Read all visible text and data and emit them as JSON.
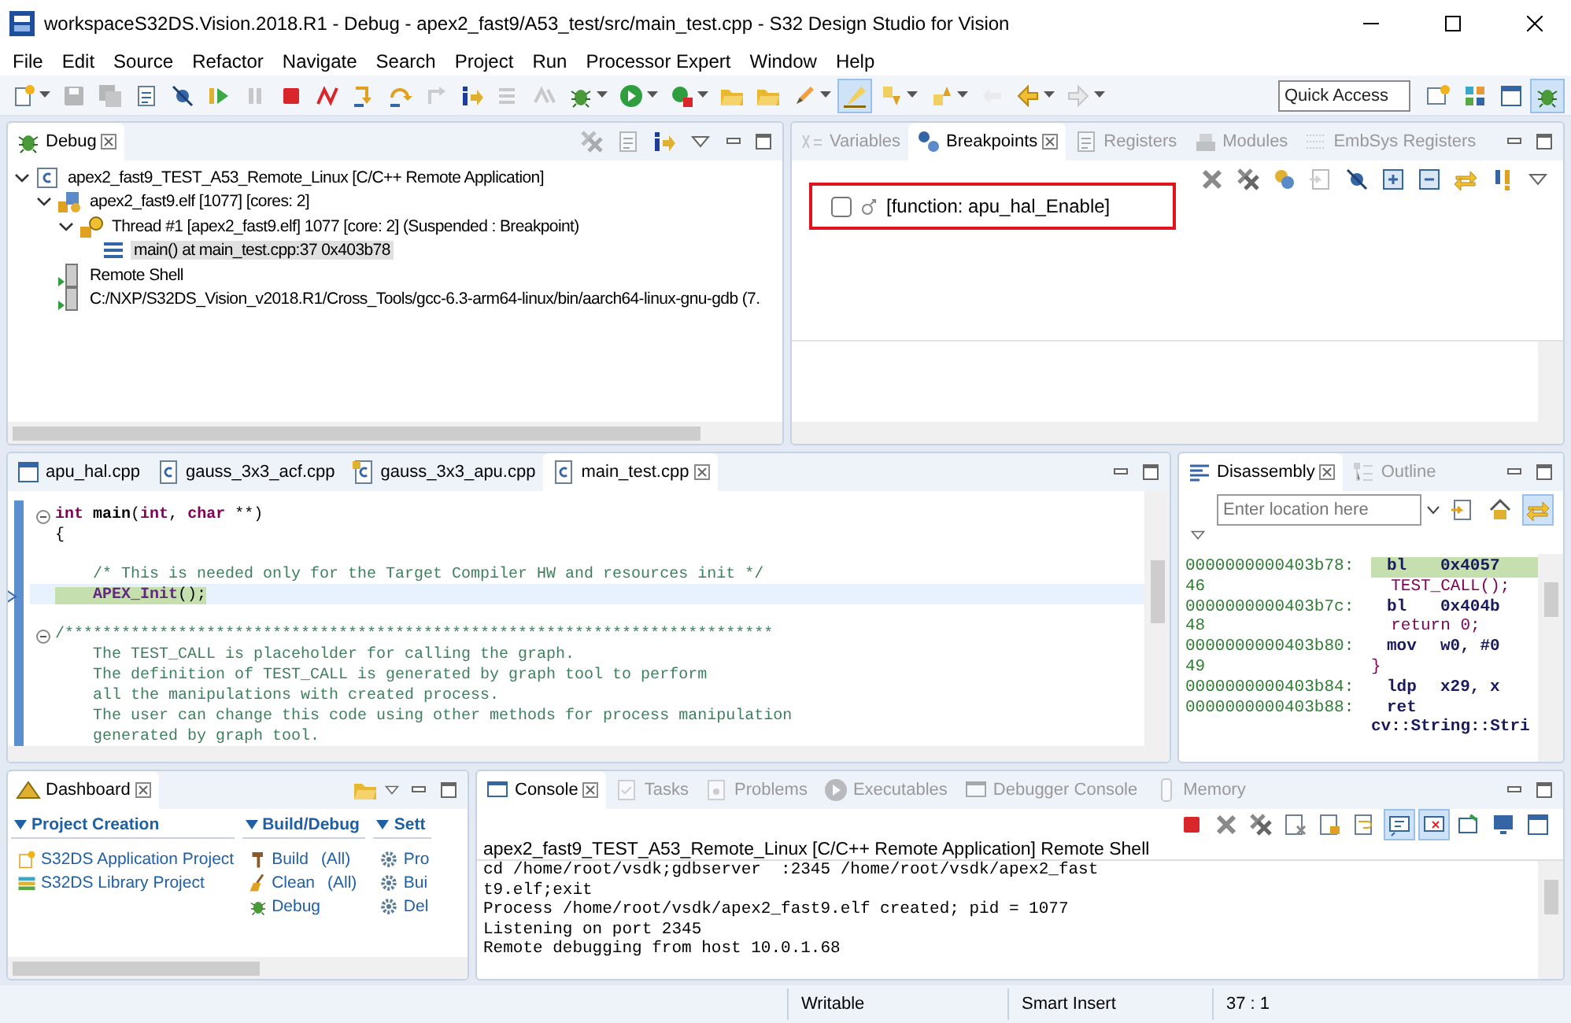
{
  "window": {
    "title": "workspaceS32DS.Vision.2018.R1 - Debug - apex2_fast9/A53_test/src/main_test.cpp - S32 Design Studio for Vision"
  },
  "menu": [
    "File",
    "Edit",
    "Source",
    "Refactor",
    "Navigate",
    "Search",
    "Project",
    "Run",
    "Processor Expert",
    "Window",
    "Help"
  ],
  "toolbar": [
    {
      "kind": "new",
      "disabled": false,
      "on": false,
      "dropdown": true
    },
    {
      "kind": "save",
      "disabled": true,
      "on": false,
      "dropdown": false
    },
    {
      "kind": "save-all",
      "disabled": true,
      "on": false,
      "dropdown": false
    },
    {
      "kind": "binary",
      "disabled": false,
      "on": false,
      "dropdown": false
    },
    {
      "kind": "skip",
      "disabled": false,
      "on": false,
      "dropdown": false
    },
    {
      "kind": "resume",
      "disabled": false,
      "on": false,
      "dropdown": false
    },
    {
      "kind": "suspend",
      "disabled": true,
      "on": false,
      "dropdown": false
    },
    {
      "kind": "terminate",
      "disabled": false,
      "on": false,
      "dropdown": false
    },
    {
      "kind": "disconnect",
      "disabled": false,
      "on": false,
      "dropdown": false
    },
    {
      "kind": "step-into",
      "disabled": false,
      "on": false,
      "dropdown": false
    },
    {
      "kind": "step-over",
      "disabled": false,
      "on": false,
      "dropdown": false
    },
    {
      "kind": "step-return",
      "disabled": true,
      "on": false,
      "dropdown": false
    },
    {
      "kind": "instr-step",
      "disabled": false,
      "on": false,
      "dropdown": false
    },
    {
      "kind": "drop-frame",
      "disabled": true,
      "on": false,
      "dropdown": false
    },
    {
      "kind": "reverse",
      "disabled": true,
      "on": false,
      "dropdown": false
    },
    {
      "kind": "bug",
      "disabled": false,
      "on": false,
      "dropdown": true
    },
    {
      "kind": "run",
      "disabled": false,
      "on": false,
      "dropdown": true
    },
    {
      "kind": "external",
      "disabled": false,
      "on": false,
      "dropdown": true
    },
    {
      "kind": "folder",
      "disabled": false,
      "on": false,
      "dropdown": false
    },
    {
      "kind": "folder",
      "disabled": false,
      "on": false,
      "dropdown": false
    },
    {
      "kind": "pen",
      "disabled": false,
      "on": false,
      "dropdown": true
    },
    {
      "kind": "highlight",
      "disabled": false,
      "on": true,
      "dropdown": false
    },
    {
      "kind": "next-ann",
      "disabled": false,
      "on": false,
      "dropdown": true
    },
    {
      "kind": "prev-ann",
      "disabled": false,
      "on": false,
      "dropdown": true
    },
    {
      "kind": "back-edit",
      "disabled": true,
      "on": false,
      "dropdown": false
    },
    {
      "kind": "back",
      "disabled": false,
      "on": false,
      "dropdown": true
    },
    {
      "kind": "forward",
      "disabled": true,
      "on": false,
      "dropdown": true
    }
  ],
  "quick_access": {
    "placeholder": "Quick Access"
  },
  "perspectives": [
    {
      "kind": "perspective",
      "selected": false
    },
    {
      "kind": "grid",
      "selected": false
    },
    {
      "kind": "window",
      "selected": false
    },
    {
      "kind": "bug",
      "selected": true
    }
  ],
  "debug_view": {
    "tabs": [
      {
        "label": "Debug",
        "kind": "bug",
        "selected": true
      }
    ],
    "toolbar": [
      {
        "kind": "remove-all",
        "disabled": true
      },
      {
        "kind": "binary",
        "disabled": true
      },
      {
        "kind": "instr-step",
        "disabled": false
      },
      {
        "kind": "menu",
        "disabled": false
      }
    ],
    "tree": [
      {
        "kind": "launch",
        "label": "apex2_fast9_TEST_A53_Remote_Linux [C/C++ Remote Application]",
        "expanded": true,
        "selected": false,
        "children": [
          {
            "kind": "process",
            "label": "apex2_fast9.elf [1077] [cores: 2]",
            "expanded": true,
            "selected": false,
            "children": [
              {
                "kind": "thread",
                "label": "Thread #1 [apex2_fast9.elf] 1077 [core: 2] (Suspended : Breakpoint)",
                "expanded": true,
                "selected": false,
                "children": [
                  {
                    "kind": "frame",
                    "label": "main() at main_test.cpp:37 0x403b78",
                    "selected": true
                  }
                ]
              }
            ]
          },
          {
            "kind": "shell",
            "label": "Remote Shell",
            "selected": false
          },
          {
            "kind": "shell",
            "label": "C:/NXP/S32DS_Vision_v2018.R1/Cross_Tools/gcc-6.3-arm64-linux/bin/aarch64-linux-gnu-gdb (7.",
            "selected": false
          }
        ]
      }
    ]
  },
  "breakpoints_view": {
    "tabs": [
      {
        "label": "Variables",
        "kind": "variables",
        "selected": false
      },
      {
        "label": "Breakpoints",
        "kind": "breakpoints",
        "selected": true
      },
      {
        "label": "Registers",
        "kind": "binary",
        "selected": false
      },
      {
        "label": "Modules",
        "kind": "modules",
        "selected": false
      },
      {
        "label": "EmbSys Registers",
        "kind": "registers",
        "selected": false
      }
    ],
    "toolbar": [
      {
        "kind": "remove",
        "disabled": false
      },
      {
        "kind": "remove-all",
        "disabled": false
      },
      {
        "kind": "link",
        "disabled": false
      },
      {
        "kind": "import",
        "disabled": true
      },
      {
        "kind": "skip",
        "disabled": false
      },
      {
        "kind": "expand",
        "disabled": false
      },
      {
        "kind": "collapse",
        "disabled": false
      },
      {
        "kind": "sync",
        "disabled": false
      },
      {
        "kind": "jump",
        "disabled": false
      },
      {
        "kind": "menu",
        "disabled": false
      }
    ],
    "breakpoints": [
      {
        "label": "[function: apu_hal_Enable]",
        "checked": false,
        "highlighted": true
      }
    ]
  },
  "editor": {
    "tabs": [
      {
        "label": "apu_hal.cpp",
        "kind": "window",
        "selected": false
      },
      {
        "label": "gauss_3x3_acf.cpp",
        "kind": "cfile",
        "selected": false
      },
      {
        "label": "gauss_3x3_apu.cpp",
        "kind": "cfile-lock",
        "selected": false
      },
      {
        "label": "main_test.cpp",
        "kind": "cfile",
        "selected": true
      }
    ],
    "lines": [
      {
        "fold": true,
        "current": false,
        "space_before": false,
        "segments": [
          {
            "kind": "keyword",
            "text": "int"
          },
          {
            "kind": "name",
            "text": " main"
          },
          {
            "kind": "text",
            "text": "("
          },
          {
            "kind": "keyword",
            "text": "int"
          },
          {
            "kind": "text",
            "text": ", "
          },
          {
            "kind": "keyword",
            "text": "char"
          },
          {
            "kind": "text",
            "text": " **)"
          }
        ]
      },
      {
        "fold": false,
        "current": false,
        "space_before": false,
        "segments": [
          {
            "kind": "text",
            "text": "{"
          }
        ]
      },
      {
        "fold": false,
        "current": false,
        "space_before": true,
        "segments": [
          {
            "kind": "comment",
            "text": "    /* This is needed only for the Target Compiler HW and resources init */"
          }
        ]
      },
      {
        "fold": false,
        "current": true,
        "space_before": false,
        "segments": [
          {
            "kind": "call",
            "text": "    APEX_Init"
          },
          {
            "kind": "text",
            "text": "();"
          }
        ]
      },
      {
        "fold": true,
        "current": false,
        "space_before": true,
        "segments": [
          {
            "kind": "comment",
            "text": "/***************************************************************************"
          }
        ]
      },
      {
        "fold": false,
        "current": false,
        "space_before": false,
        "segments": [
          {
            "kind": "comment",
            "text": "    The TEST_CALL is placeholder for calling the graph."
          }
        ]
      },
      {
        "fold": false,
        "current": false,
        "space_before": false,
        "segments": [
          {
            "kind": "comment",
            "text": "    The definition of TEST_CALL is generated by graph tool to perform"
          }
        ]
      },
      {
        "fold": false,
        "current": false,
        "space_before": false,
        "segments": [
          {
            "kind": "comment",
            "text": "    all the manipulations with created process."
          }
        ]
      },
      {
        "fold": false,
        "current": false,
        "space_before": false,
        "segments": [
          {
            "kind": "comment",
            "text": "    The user can change this code using other methods for process manipulation"
          }
        ]
      },
      {
        "fold": false,
        "current": false,
        "space_before": false,
        "segments": [
          {
            "kind": "comment",
            "text": "    generated by graph tool."
          }
        ]
      }
    ]
  },
  "disassembly_view": {
    "tabs": [
      {
        "label": "Disassembly",
        "kind": "disasm",
        "selected": true
      },
      {
        "label": "Outline",
        "kind": "outline",
        "selected": false
      }
    ],
    "location": {
      "placeholder": "Enter location here"
    },
    "toolbar": [
      {
        "kind": "import",
        "on": false
      },
      {
        "kind": "home",
        "on": false
      },
      {
        "kind": "sync",
        "on": true
      }
    ],
    "rows": [
      {
        "kind": "instr",
        "address": "0000000000403b78:",
        "mnemonic": "bl",
        "operand": "0x4057",
        "current": true
      },
      {
        "kind": "source",
        "address": "46",
        "code": "  TEST_CALL();"
      },
      {
        "kind": "instr",
        "address": "0000000000403b7c:",
        "mnemonic": "bl",
        "operand": "0x404b",
        "current": false
      },
      {
        "kind": "source",
        "address": "48",
        "code": "  return 0;"
      },
      {
        "kind": "instr",
        "address": "0000000000403b80:",
        "mnemonic": "mov",
        "operand": "w0, #0",
        "current": false
      },
      {
        "kind": "source",
        "address": "49",
        "code": "}"
      },
      {
        "kind": "instr",
        "address": "0000000000403b84:",
        "mnemonic": "ldp",
        "operand": "x29, x",
        "current": false
      },
      {
        "kind": "instr",
        "address": "0000000000403b88:",
        "mnemonic": "ret",
        "operand": "",
        "current": false
      },
      {
        "kind": "label",
        "code": "cv::String::Stri"
      }
    ]
  },
  "dashboard": {
    "tabs": [
      {
        "label": "Dashboard",
        "kind": "dashboard",
        "selected": true
      }
    ],
    "sections": [
      {
        "title": "Project Creation",
        "items": [
          {
            "kind": "app",
            "label": "S32DS Application Project"
          },
          {
            "kind": "lib",
            "label": "S32DS Library Project"
          }
        ]
      },
      {
        "title": "Build/Debug",
        "items": [
          {
            "kind": "hammer",
            "label": "Build",
            "suffix": "(All)"
          },
          {
            "kind": "broom",
            "label": "Clean",
            "suffix": "(All)"
          },
          {
            "kind": "bug",
            "label": "Debug"
          }
        ]
      },
      {
        "title": "Sett",
        "items": [
          {
            "kind": "gear",
            "label": "Pro"
          },
          {
            "kind": "gear",
            "label": "Bui"
          },
          {
            "kind": "gear",
            "label": "Del"
          }
        ]
      }
    ]
  },
  "console": {
    "tabs": [
      {
        "label": "Console",
        "kind": "console",
        "selected": true
      },
      {
        "label": "Tasks",
        "kind": "tasks",
        "selected": false
      },
      {
        "label": "Problems",
        "kind": "problems",
        "selected": false
      },
      {
        "label": "Executables",
        "kind": "run",
        "selected": false
      },
      {
        "label": "Debugger Console",
        "kind": "console",
        "selected": false
      },
      {
        "label": "Memory",
        "kind": "memory",
        "selected": false
      }
    ],
    "toolbar": [
      {
        "kind": "terminate",
        "on": false
      },
      {
        "kind": "remove",
        "on": false
      },
      {
        "kind": "remove-all",
        "on": false
      },
      {
        "kind": "clear",
        "on": false
      },
      {
        "kind": "lock",
        "on": false
      },
      {
        "kind": "wrap",
        "on": false
      },
      {
        "kind": "pin",
        "on": true
      },
      {
        "kind": "display",
        "on": true
      },
      {
        "kind": "newconsole",
        "on": false
      },
      {
        "kind": "monitor",
        "on": false
      },
      {
        "kind": "window",
        "on": false
      }
    ],
    "header": "apex2_fast9_TEST_A53_Remote_Linux [C/C++ Remote Application] Remote Shell",
    "lines": [
      "cd /home/root/vsdk;gdbserver  :2345 /home/root/vsdk/apex2_fast",
      "t9.elf;exit",
      "Process /home/root/vsdk/apex2_fast9.elf created; pid = 1077",
      "Listening on port 2345",
      "Remote debugging from host 10.0.1.68"
    ]
  },
  "status_bar": [
    "Writable",
    "Smart Insert",
    "37 : 1"
  ]
}
